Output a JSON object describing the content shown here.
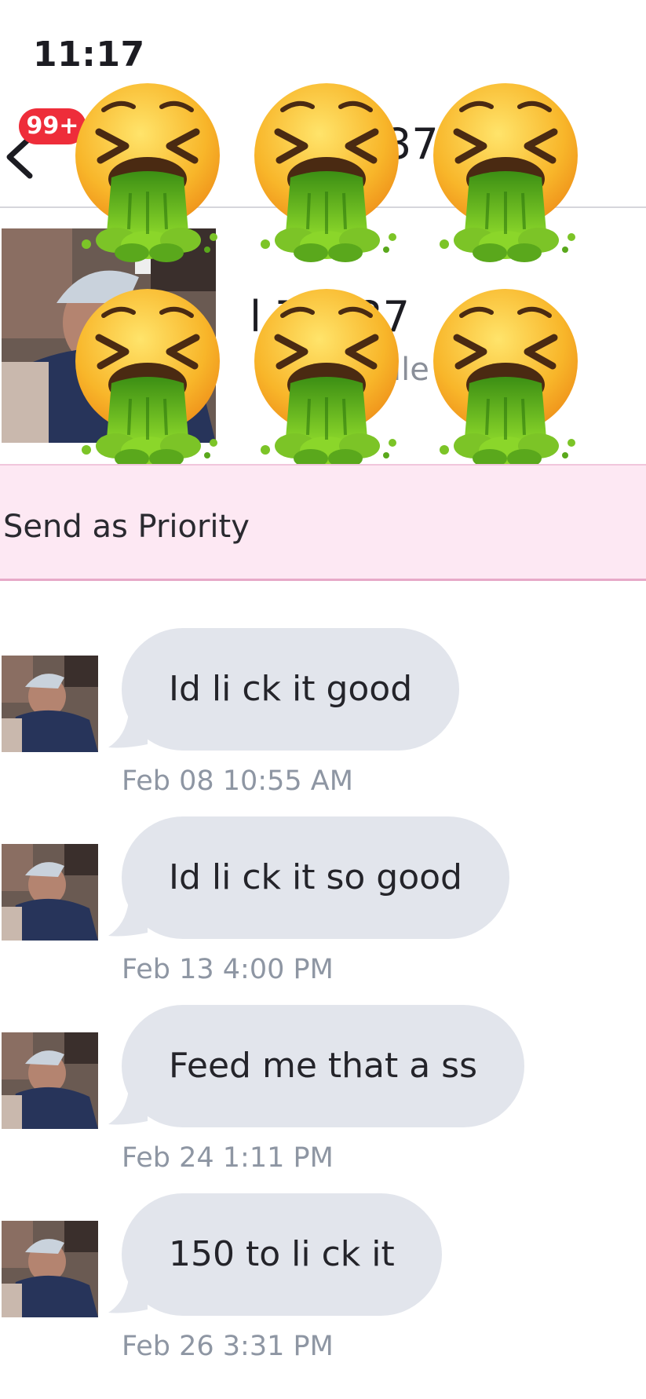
{
  "status_bar": {
    "time": "11:17"
  },
  "header": {
    "back_icon": "chevron-left-icon",
    "unread_badge": "99+",
    "title_visible": "37"
  },
  "profile": {
    "name_visible": "l        73737",
    "subtitle_visible": "lle"
  },
  "overlay": {
    "emoji_icon": "vomiting-face-icon"
  },
  "priority": {
    "label": "Send as Priority"
  },
  "messages": [
    {
      "text": "Id li ck it good",
      "time": "Feb 08 10:55 AM"
    },
    {
      "text": "Id li ck it so good",
      "time": "Feb 13 4:00 PM"
    },
    {
      "text": "Feed me that a ss",
      "time": "Feb 24 1:11 PM"
    },
    {
      "text": "150 to li ck it",
      "time": "Feb 26 3:31 PM"
    }
  ],
  "colors": {
    "badge": "#ee2d3a",
    "bubble": "#e2e5ec",
    "priority_bg": "#fde8f3",
    "timestamp": "#8e96a3"
  }
}
